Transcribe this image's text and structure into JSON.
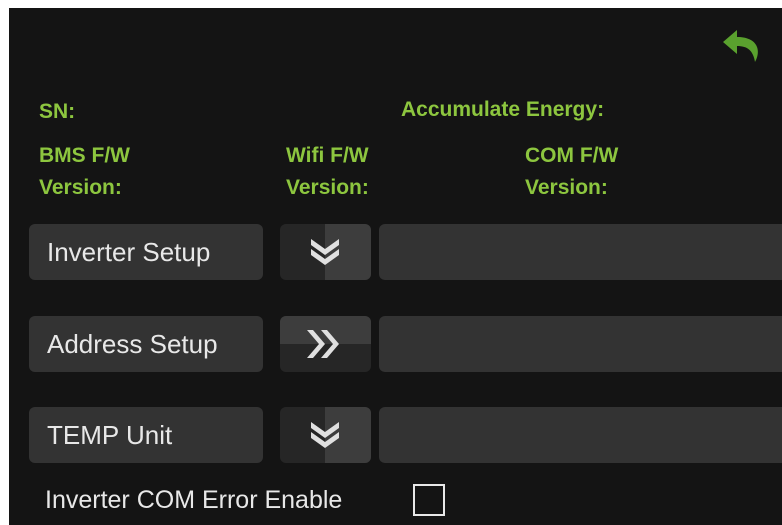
{
  "colors": {
    "accent": "#8dc63f",
    "background": "#141414",
    "button": "#333333",
    "text": "#e8e8e8"
  },
  "header": {
    "back_icon": "back-arrow-icon"
  },
  "info": {
    "sn_label": "SN:",
    "energy_label": "Accumulate Energy:",
    "bms_label": "BMS F/W\nVersion:",
    "wifi_label": "Wifi F/W\nVersion:",
    "com_label": "COM F/W\nVersion:"
  },
  "settings": [
    {
      "label": "Inverter Setup",
      "toggle_icon": "chevron-down-icon",
      "value": ""
    },
    {
      "label": "Address Setup",
      "toggle_icon": "chevron-right-icon",
      "value": ""
    },
    {
      "label": "TEMP Unit",
      "toggle_icon": "chevron-down-icon",
      "value": ""
    }
  ],
  "com_error": {
    "label": "Inverter COM Error Enable",
    "checked": false
  }
}
